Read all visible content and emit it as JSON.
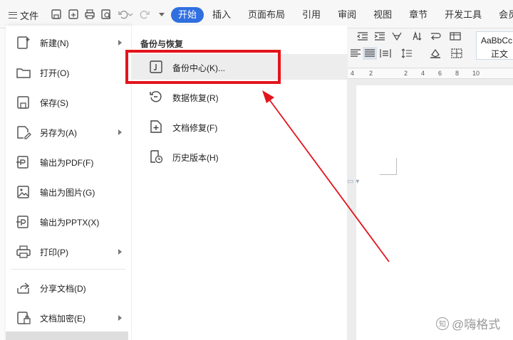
{
  "toolbar": {
    "file_label": "文件",
    "tabs": [
      "开始",
      "插入",
      "页面布局",
      "引用",
      "审阅",
      "视图",
      "章节",
      "开发工具",
      "会员专享"
    ]
  },
  "ribbon": {
    "style_preview": "AaBbCcD",
    "style_name": "正文"
  },
  "ruler": {
    "ticks": [
      "4",
      "2",
      "2",
      "4",
      "6",
      "8",
      "10"
    ]
  },
  "file_menu": {
    "items": [
      {
        "label": "新建(N)",
        "icon": "new-doc-icon",
        "has_arrow": true
      },
      {
        "label": "打开(O)",
        "icon": "folder-icon",
        "has_arrow": false
      },
      {
        "label": "保存(S)",
        "icon": "save-icon",
        "has_arrow": false
      },
      {
        "label": "另存为(A)",
        "icon": "save-as-icon",
        "has_arrow": true
      },
      {
        "label": "输出为PDF(F)",
        "icon": "pdf-icon",
        "has_arrow": false
      },
      {
        "label": "输出为图片(G)",
        "icon": "image-export-icon",
        "has_arrow": false
      },
      {
        "label": "输出为PPTX(X)",
        "icon": "pptx-export-icon",
        "has_arrow": false
      },
      {
        "label": "打印(P)",
        "icon": "printer-icon",
        "has_arrow": true
      },
      {
        "label": "分享文档(D)",
        "icon": "share-icon",
        "has_arrow": false
      },
      {
        "label": "文档加密(E)",
        "icon": "encrypt-icon",
        "has_arrow": true
      }
    ]
  },
  "submenu": {
    "title": "备份与恢复",
    "items": [
      {
        "label": "备份中心(K)...",
        "icon": "backup-center-icon"
      },
      {
        "label": "数据恢复(R)",
        "icon": "data-recovery-icon"
      },
      {
        "label": "文档修复(F)",
        "icon": "doc-repair-icon"
      },
      {
        "label": "历史版本(H)",
        "icon": "history-version-icon"
      }
    ]
  },
  "watermark": {
    "text": "@嗨格式"
  },
  "colors": {
    "accent": "#2f6fe0",
    "highlight_box": "#e3141b"
  }
}
